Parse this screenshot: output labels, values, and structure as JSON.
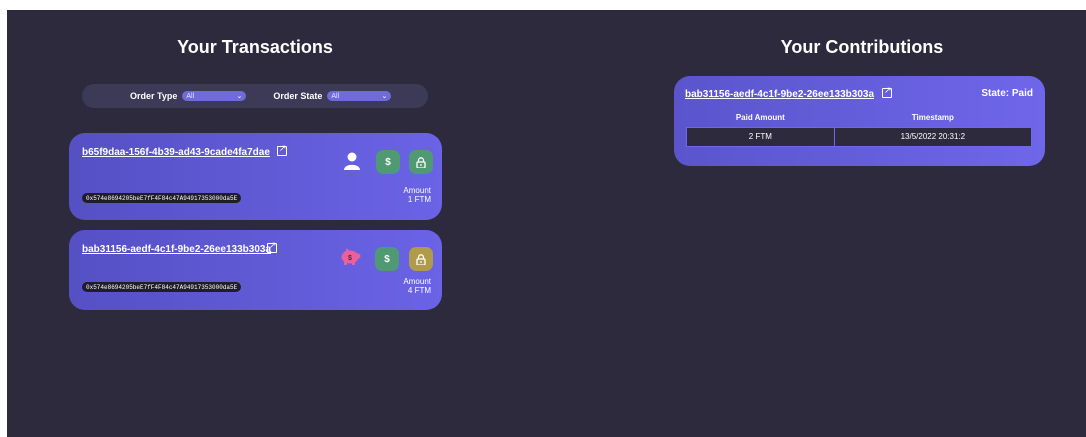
{
  "transactions": {
    "title": "Your Transactions",
    "filters": {
      "order_type_label": "Order Type",
      "order_type_value": "All",
      "order_state_label": "Order State",
      "order_state_value": "All"
    },
    "items": [
      {
        "id": "b65f9daa-156f-4b39-ad43-9cade4fa7dae",
        "address": "0x574e8694205beE7fF4F84c47A94917353000da5E",
        "role_icon": "user-icon",
        "amount_label": "Amount",
        "amount_value": "1 FTM",
        "buttons": [
          {
            "icon": "dollar-icon",
            "glyph": "$",
            "color": "#4f9a72"
          },
          {
            "icon": "lock-icon",
            "glyph": "🔒",
            "color": "#4f9a72"
          }
        ]
      },
      {
        "id": "bab31156-aedf-4c1f-9be2-26ee133b303a",
        "address": "0x574e8694205beE7fF4F84c47A94917353000da5E",
        "role_icon": "piggy-bank-icon",
        "amount_label": "Amount",
        "amount_value": "4 FTM",
        "buttons": [
          {
            "icon": "dollar-icon",
            "glyph": "$",
            "color": "#4f9a72"
          },
          {
            "icon": "lock-icon",
            "glyph": "🔒",
            "color": "#b09b4a"
          }
        ]
      }
    ]
  },
  "contributions": {
    "title": "Your Contributions",
    "items": [
      {
        "id": "bab31156-aedf-4c1f-9be2-26ee133b303a",
        "state": "State: Paid",
        "columns": [
          "Paid Amount",
          "Timestamp"
        ],
        "rows": [
          [
            "2 FTM",
            "13/5/2022 20:31:2"
          ]
        ]
      }
    ]
  }
}
